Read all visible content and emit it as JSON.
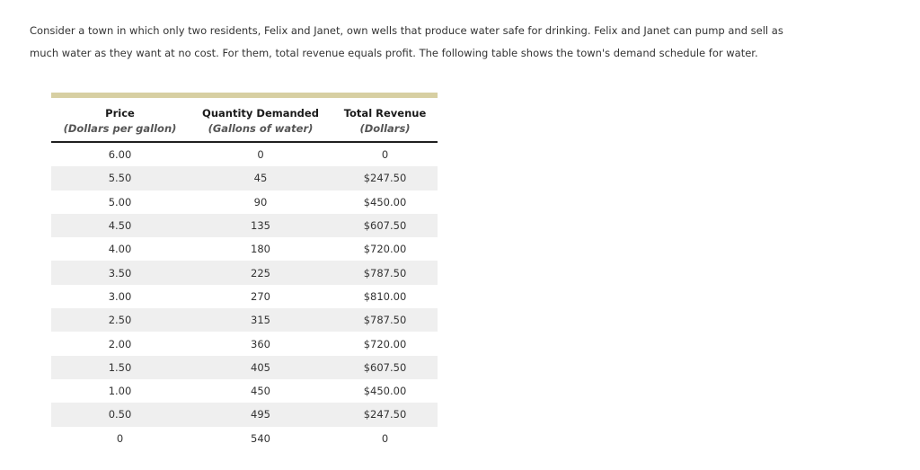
{
  "intro": {
    "lines": [
      "Consider a town in which only two residents, Felix and Janet, own wells that produce water safe for drinking. Felix and Janet can pump and sell as",
      "much water as they want at no cost. For them, total revenue equals profit. The following table shows the town's demand schedule for water."
    ]
  },
  "table": {
    "columns": [
      {
        "label": "Price",
        "unit": "(Dollars per gallon)"
      },
      {
        "label": "Quantity Demanded",
        "unit": "(Gallons of water)"
      },
      {
        "label": "Total Revenue",
        "unit": "(Dollars)"
      }
    ],
    "rows": [
      {
        "price": "6.00",
        "quantity": "0",
        "revenue": "0"
      },
      {
        "price": "5.50",
        "quantity": "45",
        "revenue": "$247.50"
      },
      {
        "price": "5.00",
        "quantity": "90",
        "revenue": "$450.00"
      },
      {
        "price": "4.50",
        "quantity": "135",
        "revenue": "$607.50"
      },
      {
        "price": "4.00",
        "quantity": "180",
        "revenue": "$720.00"
      },
      {
        "price": "3.50",
        "quantity": "225",
        "revenue": "$787.50"
      },
      {
        "price": "3.00",
        "quantity": "270",
        "revenue": "$810.00"
      },
      {
        "price": "2.50",
        "quantity": "315",
        "revenue": "$787.50"
      },
      {
        "price": "2.00",
        "quantity": "360",
        "revenue": "$720.00"
      },
      {
        "price": "1.50",
        "quantity": "405",
        "revenue": "$607.50"
      },
      {
        "price": "1.00",
        "quantity": "450",
        "revenue": "$450.00"
      },
      {
        "price": "0.50",
        "quantity": "495",
        "revenue": "$247.50"
      },
      {
        "price": "0",
        "quantity": "540",
        "revenue": "0"
      }
    ]
  },
  "colors": {
    "accent_bar": "#d7cfa2",
    "row_stripe": "#efefef",
    "header_rule": "#1f1f1f",
    "body_text": "#333333",
    "unit_text": "#555555"
  }
}
